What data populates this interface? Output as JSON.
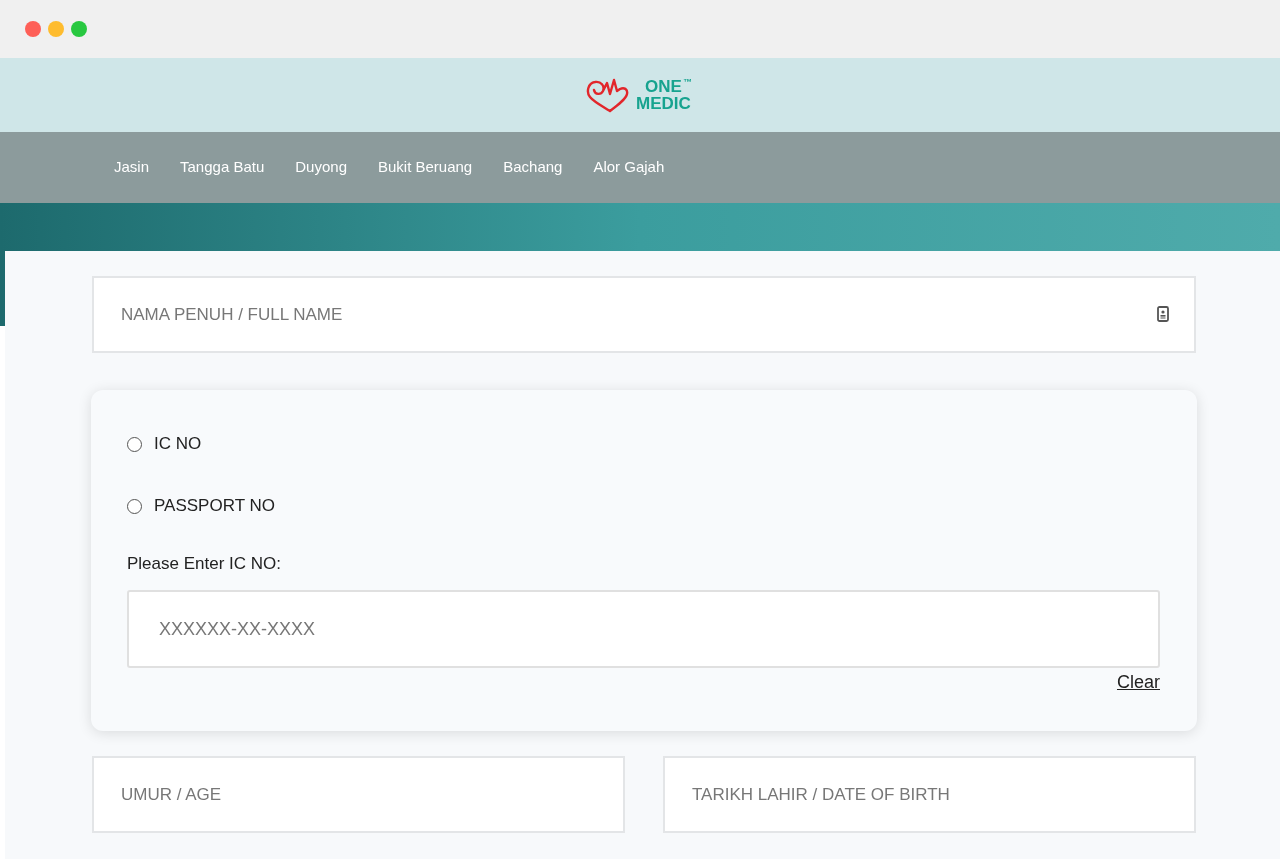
{
  "logo": {
    "name_top": "ONE",
    "mark": "™",
    "name_bottom": "MEDIC"
  },
  "nav": {
    "items": [
      {
        "label": "Jasin"
      },
      {
        "label": "Tangga Batu"
      },
      {
        "label": "Duyong"
      },
      {
        "label": "Bukit Beruang"
      },
      {
        "label": "Bachang"
      },
      {
        "label": "Alor Gajah"
      }
    ]
  },
  "form": {
    "full_name": {
      "placeholder": "NAMA PENUH / FULL NAME"
    },
    "identity": {
      "options": [
        {
          "label": "IC NO",
          "selected": false
        },
        {
          "label": "PASSPORT NO",
          "selected": false
        }
      ],
      "prompt": "Please Enter IC NO:",
      "id_field": {
        "placeholder": "XXXXXX-XX-XXXX"
      },
      "clear_link": "Clear"
    },
    "age": {
      "placeholder": "UMUR / AGE"
    },
    "date_of_birth": {
      "placeholder": "TARIKH LAHIR / DATE OF BIRTH"
    }
  }
}
